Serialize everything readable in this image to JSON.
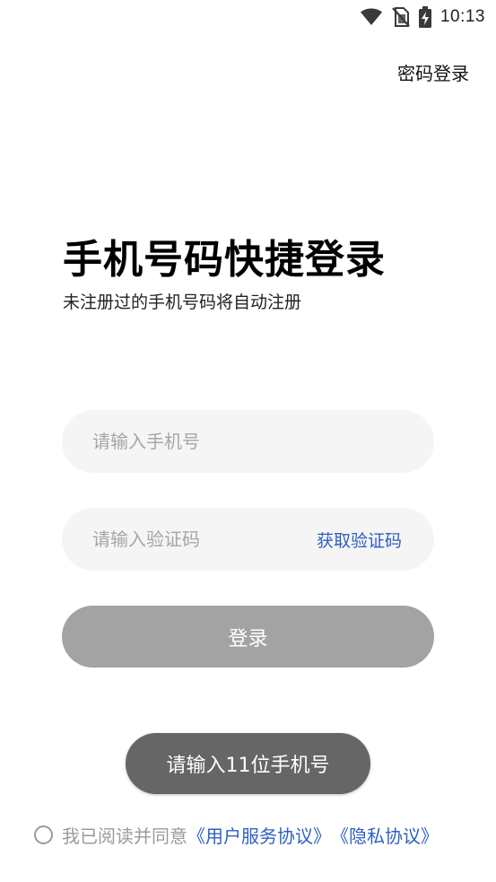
{
  "status_bar": {
    "time": "10:13",
    "icons": [
      "wifi-icon",
      "no-sim-icon",
      "battery-charging-icon"
    ]
  },
  "header": {
    "password_login_label": "密码登录"
  },
  "main": {
    "title": "手机号码快捷登录",
    "subtitle": "未注册过的手机号码将自动注册",
    "phone_input": {
      "placeholder": "请输入手机号",
      "value": ""
    },
    "code_input": {
      "placeholder": "请输入验证码",
      "value": ""
    },
    "get_code_label": "获取验证码",
    "login_label": "登录"
  },
  "toast": {
    "message": "请输入11位手机号"
  },
  "agreement": {
    "checked": false,
    "prefix": "我已阅读并同意",
    "user_agreement": "《用户服务协议》",
    "privacy_policy": "《隐私协议》"
  },
  "colors": {
    "link": "#2f5fc2",
    "input_bg": "#f5f5f5",
    "button_disabled": "#a3a3a3",
    "toast_bg": "#666666",
    "muted_text": "#9a9a9a"
  }
}
